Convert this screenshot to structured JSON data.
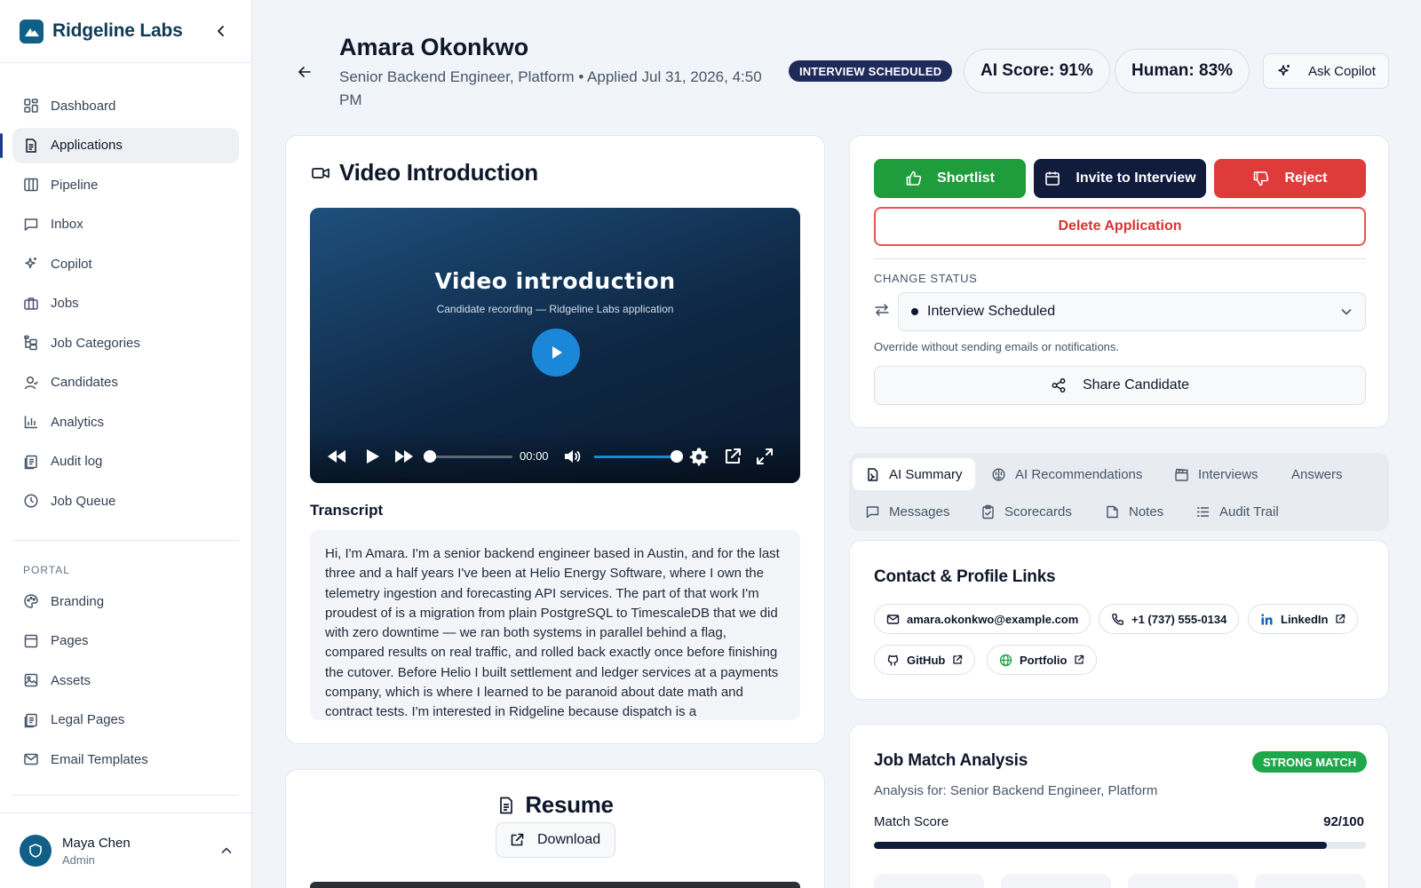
{
  "brand": {
    "name": "Ridgeline Labs"
  },
  "sidebar": {
    "nav": [
      {
        "label": "Dashboard",
        "icon": "dashboard-icon"
      },
      {
        "label": "Applications",
        "icon": "document-icon",
        "active": true
      },
      {
        "label": "Pipeline",
        "icon": "columns-icon"
      },
      {
        "label": "Inbox",
        "icon": "message-icon"
      },
      {
        "label": "Copilot",
        "icon": "sparkle-icon"
      },
      {
        "label": "Jobs",
        "icon": "briefcase-icon"
      },
      {
        "label": "Job Categories",
        "icon": "tree-icon"
      },
      {
        "label": "Candidates",
        "icon": "user-icon"
      },
      {
        "label": "Analytics",
        "icon": "bar-chart-icon"
      },
      {
        "label": "Audit log",
        "icon": "log-icon"
      },
      {
        "label": "Job Queue",
        "icon": "clock-icon"
      }
    ],
    "portal_label": "PORTAL",
    "portal": [
      {
        "label": "Branding",
        "icon": "palette-icon"
      },
      {
        "label": "Pages",
        "icon": "page-icon"
      },
      {
        "label": "Assets",
        "icon": "image-icon"
      },
      {
        "label": "Legal Pages",
        "icon": "legal-icon"
      },
      {
        "label": "Email Templates",
        "icon": "mail-icon"
      }
    ],
    "user": {
      "name": "Maya Chen",
      "role": "Admin"
    }
  },
  "header": {
    "name": "Amara Okonkwo",
    "subtitle": "Senior Backend Engineer, Platform • Applied Jul 31, 2026, 4:50 PM",
    "status": "INTERVIEW SCHEDULED",
    "ai_score": "AI Score: 91%",
    "human_score": "Human: 83%",
    "copilot_label": "Ask Copilot"
  },
  "video": {
    "section_title": "Video Introduction",
    "heading": "Video introduction",
    "caption": "Candidate recording — Ridgeline Labs application",
    "time": "00:00",
    "progress": 0,
    "volume": 1.0,
    "transcript_label": "Transcript",
    "transcript": "Hi, I'm Amara. I'm a senior backend engineer based in Austin, and for the last three and a half years I've been at Helio Energy Software, where I own the telemetry ingestion and forecasting API services. The part of that work I'm proudest of is a migration from plain PostgreSQL to TimescaleDB that we did with zero downtime — we ran both systems in parallel behind a flag, compared results on real traffic, and rolled back exactly once before finishing the cutover. Before Helio I built settlement and ledger services at a payments company, which is where I learned to be paranoid about date math and contract tests. I'm interested in Ridgeline because dispatch is a"
  },
  "resume": {
    "title": "Resume",
    "download_label": "Download"
  },
  "actions": {
    "shortlist": "Shortlist",
    "invite": "Invite to Interview",
    "reject": "Reject",
    "delete": "Delete Application",
    "change_status_label": "CHANGE STATUS",
    "status_value": "Interview Scheduled",
    "override_note": "Override without sending emails or notifications.",
    "share": "Share Candidate"
  },
  "tabs": [
    {
      "label": "AI Summary",
      "active": true
    },
    {
      "label": "AI Recommendations"
    },
    {
      "label": "Interviews"
    },
    {
      "label": "Answers"
    },
    {
      "label": "Messages"
    },
    {
      "label": "Scorecards"
    },
    {
      "label": "Notes"
    },
    {
      "label": "Audit Trail"
    }
  ],
  "contact": {
    "title": "Contact & Profile Links",
    "email": "amara.okonkwo@example.com",
    "phone": "+1 (737) 555-0134",
    "linkedin": "LinkedIn",
    "github": "GitHub",
    "portfolio": "Portfolio"
  },
  "match": {
    "title": "Job Match Analysis",
    "badge": "STRONG MATCH",
    "analysis_for": "Analysis for: Senior Backend Engineer, Platform",
    "score_label": "Match Score",
    "score_text": "92/100",
    "score": 92
  },
  "colors": {
    "brand": "#0f5f86",
    "navy": "#111c3d",
    "success": "#1f9d3c",
    "danger": "#e03b3b",
    "video_accent": "#1a87d8"
  }
}
